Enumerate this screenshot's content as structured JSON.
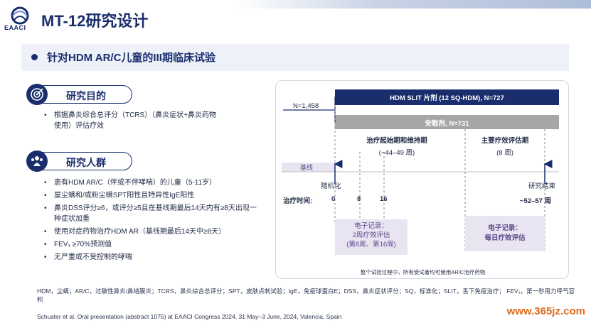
{
  "header": {
    "logo_text": "EAACI",
    "title": "MT-12研究设计"
  },
  "subtitle": "针对HDM AR/C儿童的III期临床试验",
  "sections": {
    "objective": {
      "title": "研究目的",
      "icon": "target-icon",
      "bullets": [
        "根据鼻炎综合总评分（TCRS）（鼻炎症状+鼻炎药物使用）评估疗效"
      ]
    },
    "population": {
      "title": "研究人群",
      "icon": "group-icon",
      "bullets": [
        "患有HDM AR/C（伴或不伴哮喘）的儿童（5-11岁）",
        "屋尘螨和/或粉尘螨SPT阳性且特异性IgE阳性",
        "鼻炎DSS评分≥6，或评分≥5且在基线期最后14天内有≥8天出现一种症状加重",
        "使用对症药物治疗HDM AR（基线期最后14天中≥8天）",
        "FEV₁ ≥70%预测值",
        "无严重或不受控制的哮喘"
      ]
    }
  },
  "diagram": {
    "n_total": "N=1,458",
    "arm_active": "HDM SLIT 片剂 (12 SQ-HDM), N=727",
    "arm_placebo": "安慰剂, N=731",
    "phase1_title": "治疗起始期和维持期",
    "phase1_sub": "(~44–49 周)",
    "phase2_title": "主要疗效评估期",
    "phase2_sub": "(8 周)",
    "baseline_label": "基线",
    "randomization_label": "随机化",
    "study_end_label": "研究结束",
    "treatment_time_label": "治疗时间:",
    "tick_0": "0",
    "tick_8": "8",
    "tick_16": "16",
    "tick_end": "~52–57 周",
    "ediary1_line1": "电子记录：",
    "ediary1_line2": "2周疗效评估",
    "ediary1_line3": "(第8周、第16周)",
    "ediary2_line1": "电子记录：",
    "ediary2_line2": "每日疗效评估",
    "note": "整个试验过程中，所有受试者均可使用AR/C治疗药物"
  },
  "colors": {
    "navy": "#1a2e6e",
    "gray_bar": "#a6a6a6",
    "lavender": "#e9e4f2",
    "watermark": "#e06a1a"
  },
  "footnotes": {
    "abbreviations": "HDM，尘螨；AR/C，过敏性鼻炎/鼻结膜炎；TCRS，鼻炎综合总评分；SPT，皮肤点刺试验；IgE，免疫球蛋白E；DSS，鼻炎症状评分；SQ，标准化；SLIT，舌下免疫治疗；  FEV₁，第一秒用力呼气容积",
    "reference": "Schuster et al. Oral presentation (abstract 1075) at EAACI Congress 2024, 31 May–3 June, 2024, Valencia, Spain"
  },
  "watermark": "www.365jz.com"
}
